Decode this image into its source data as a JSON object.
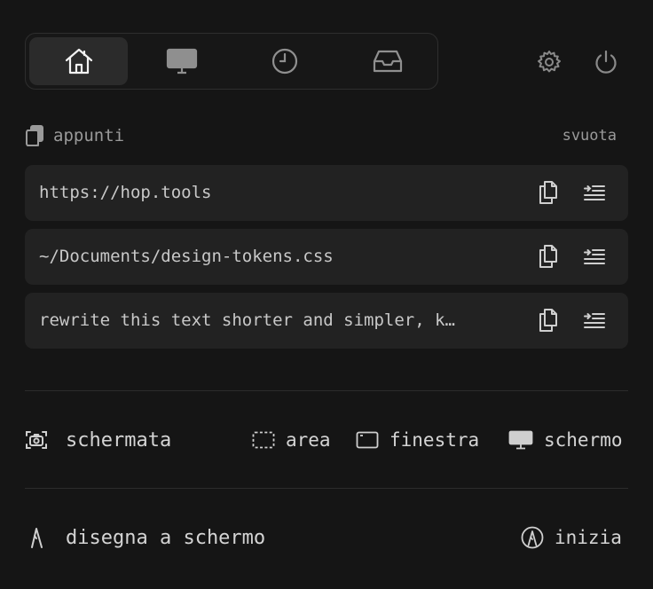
{
  "tabs": [
    {
      "name": "home-icon",
      "active": true
    },
    {
      "name": "monitor-icon",
      "active": false
    },
    {
      "name": "clock-icon",
      "active": false
    },
    {
      "name": "inbox-icon",
      "active": false
    }
  ],
  "clipboard": {
    "title": "appunti",
    "clear_label": "svuota",
    "items": [
      {
        "text": "https://hop.tools"
      },
      {
        "text": "~/Documents/design-tokens.css"
      },
      {
        "text": "rewrite this text shorter and simpler, k…"
      }
    ]
  },
  "screenshot": {
    "label": "schermata",
    "options": [
      "area",
      "finestra",
      "schermo"
    ]
  },
  "draw": {
    "label": "disegna a schermo",
    "action_label": "inizia"
  },
  "colors": {
    "background": "#151515",
    "card": "#222222",
    "active_tab": "#2b2b2b"
  }
}
